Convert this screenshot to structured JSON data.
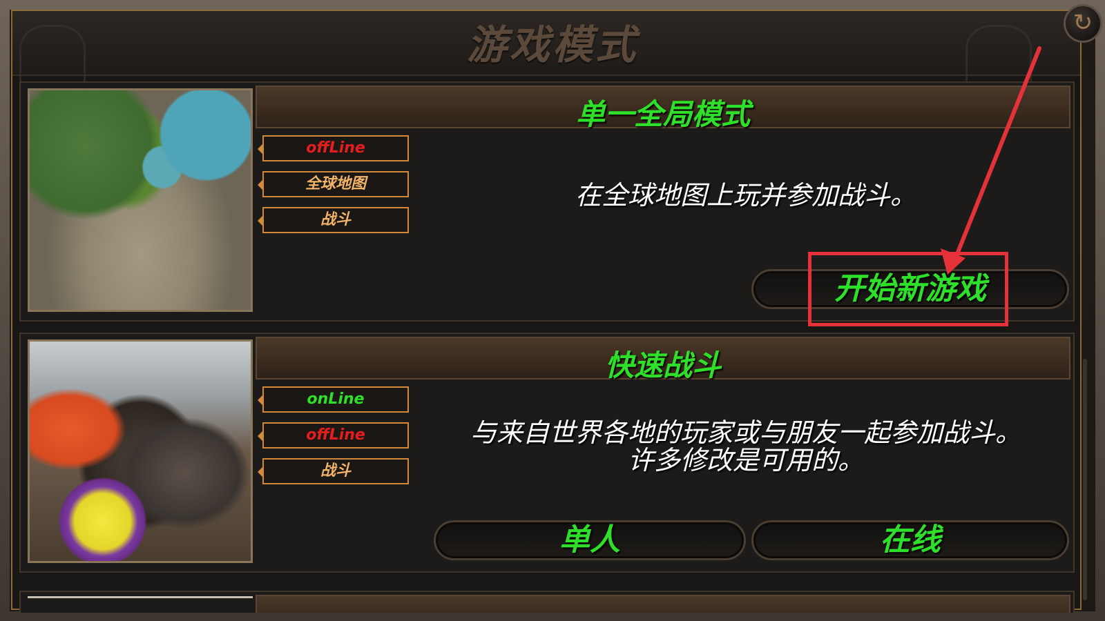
{
  "page_title": "游戏模式",
  "back_icon": "↻",
  "colors": {
    "accent_green": "#2fe02a",
    "tag_red": "#e41e1e",
    "tag_orange": "#f3b46a",
    "highlight_red": "#e5323a"
  },
  "modes": [
    {
      "title": "单一全局模式",
      "tags": [
        {
          "label": "offLine",
          "color": "red"
        },
        {
          "label": "全球地图",
          "color": "orange"
        },
        {
          "label": "战斗",
          "color": "orange"
        }
      ],
      "description": "在全球地图上玩并参加战斗。",
      "buttons": [
        {
          "label": "开始新游戏"
        }
      ],
      "thumbnail": "global-map-terrain"
    },
    {
      "title": "快速战斗",
      "tags": [
        {
          "label": "onLine",
          "color": "green"
        },
        {
          "label": "offLine",
          "color": "red"
        },
        {
          "label": "战斗",
          "color": "orange"
        }
      ],
      "description_line1": "与来自世界各地的玩家或与朋友一起参加战斗。",
      "description_line2": "许多修改是可用的。",
      "buttons": [
        {
          "label": "单人"
        },
        {
          "label": "在线"
        }
      ],
      "thumbnail": "battle-scene"
    }
  ]
}
